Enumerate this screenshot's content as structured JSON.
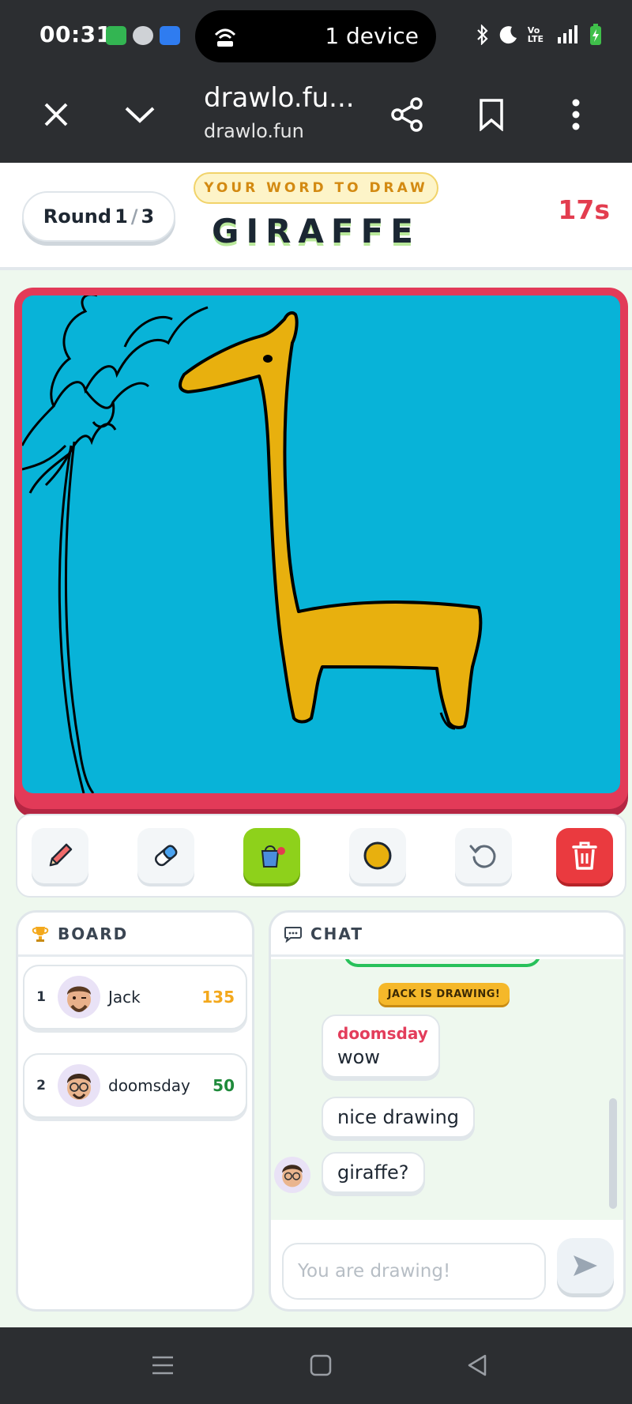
{
  "status_bar": {
    "time": "00:31",
    "device_label": "1 device"
  },
  "browser": {
    "title": "drawlo.fu...",
    "url": "drawlo.fun"
  },
  "game": {
    "round_label": "Round",
    "round_current": "1",
    "round_sep": "/",
    "round_total": "3",
    "word_tag": "YOUR WORD TO DRAW",
    "word": "GIRAFFE",
    "timer": "17s"
  },
  "tools": [
    "pencil-icon",
    "eraser-icon",
    "fill-bucket-icon",
    "color-swatch",
    "undo-icon",
    "trash-icon"
  ],
  "colors": {
    "canvas": "#08b3d8",
    "giraffe": "#e8b00e",
    "border": "#e23a58",
    "accent_green": "#8ed11b",
    "danger": "#ea3a3f"
  },
  "board": {
    "title": "BOARD",
    "players": [
      {
        "rank": "1",
        "name": "Jack",
        "score": "135",
        "score_color": "#f3a81c"
      },
      {
        "rank": "2",
        "name": "doomsday",
        "score": "50",
        "score_color": "#1f8a3b"
      }
    ]
  },
  "chat": {
    "title": "CHAT",
    "system": "JACK IS DRAWING!",
    "messages": [
      {
        "author": "doomsday",
        "text": "wow"
      },
      {
        "text": "nice drawing"
      },
      {
        "text": "giraffe?"
      }
    ],
    "input_placeholder": "You are drawing!"
  }
}
